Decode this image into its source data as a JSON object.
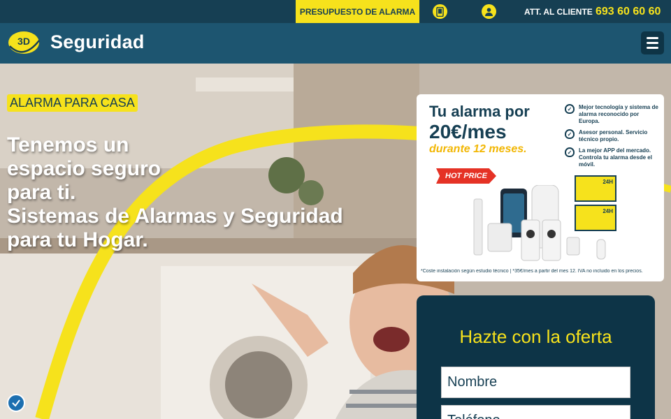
{
  "topbar": {
    "budget_label": "PRESUPUESTO DE ALARMA",
    "phone_icon": "phone-icon",
    "user_icon": "user-icon",
    "att_label": "ATT. AL CLIENTE",
    "phone_number": "693 60 60 60"
  },
  "header": {
    "logo_badge": "3D",
    "logo_text": "Seguridad",
    "menu_icon": "menu-icon"
  },
  "hero": {
    "tag": "ALARMA PARA CASA",
    "headline": [
      "Tenemos un",
      "espacio seguro",
      "para ti.",
      "Sistemas de Alarmas y Seguridad",
      "para tu Hogar."
    ]
  },
  "promo": {
    "line1": "Tu alarma por",
    "line2": "20€/mes",
    "line3": "durante 12 meses.",
    "hot": "HOT PRICE",
    "bullets": [
      "Mejor tecnología y sistema de alarma reconocido por Europa.",
      "Asesor personal. Servicio técnico propio.",
      "La mejor APP del mercado. Controla tu alarma desde el móvil."
    ],
    "sign_label": "24H",
    "fineprint": "*Coste instalación según estudio técnico | *35€/mes a partir del mes 12. IVA no incluido en los precios."
  },
  "offer": {
    "title": "Hazte con la oferta",
    "name_placeholder": "Nombre",
    "tel_placeholder": "Teléfono"
  },
  "colors": {
    "accent": "#f6e21c",
    "navy": "#163f53",
    "header": "#1d5570",
    "form_bg": "#0d3447"
  }
}
